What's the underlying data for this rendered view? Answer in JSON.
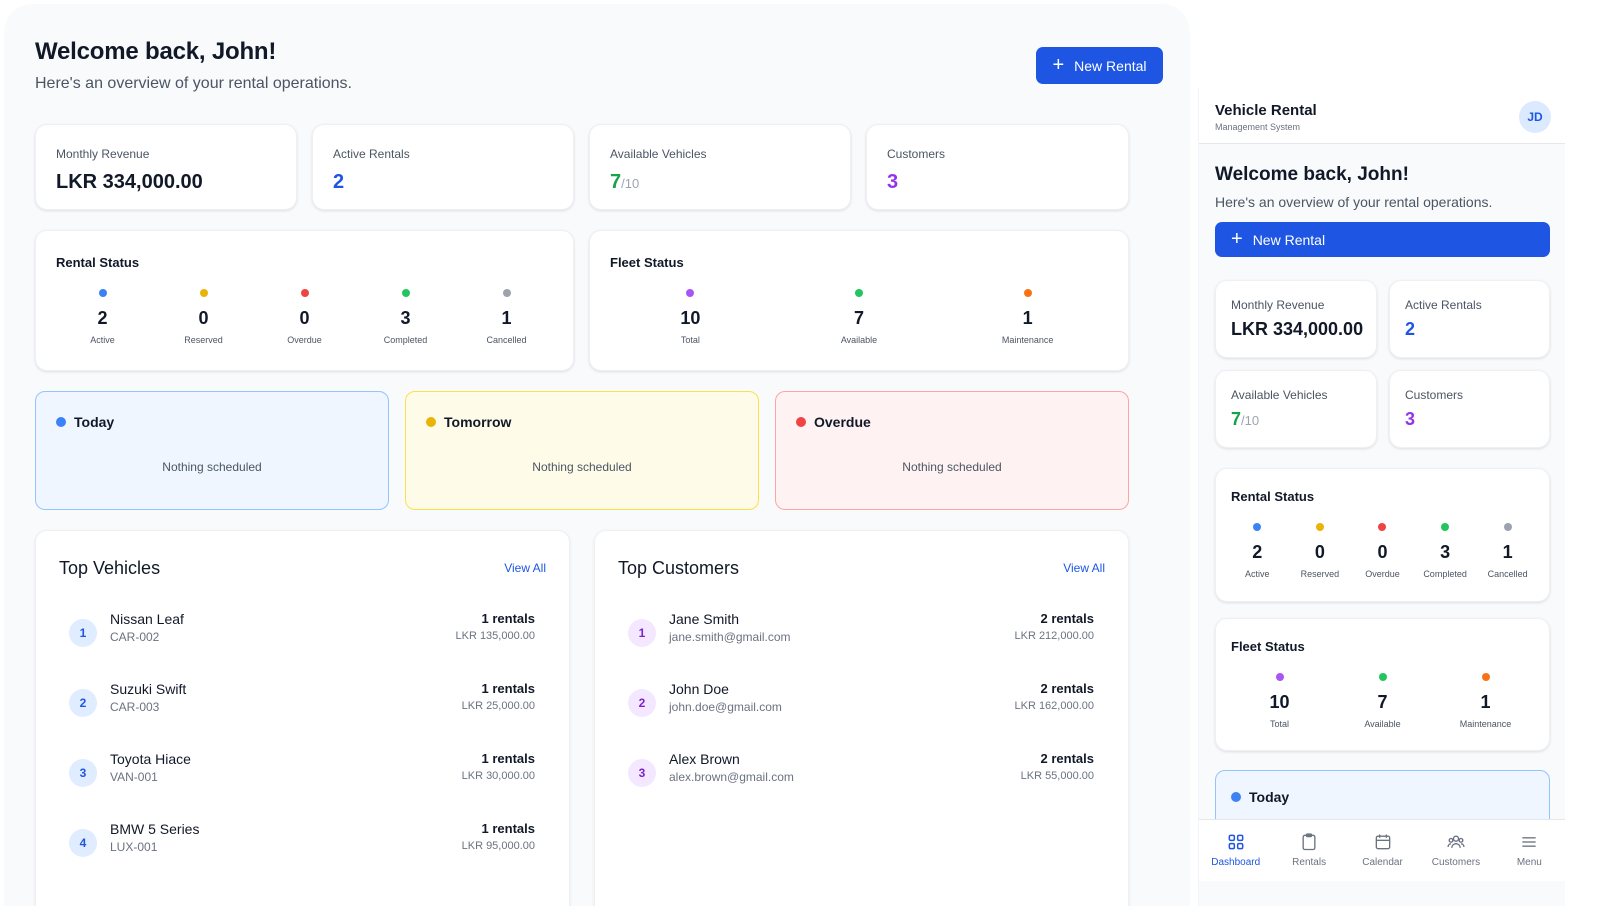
{
  "welcome": "Welcome back, John!",
  "subtitle": "Here's an overview of your rental operations.",
  "new_rental": "New Rental",
  "stats": {
    "revenue_label": "Monthly Revenue",
    "revenue_value": "LKR 334,000.00",
    "active_label": "Active Rentals",
    "active_value": "2",
    "available_label": "Available Vehicles",
    "available_value": "7",
    "available_total": "/10",
    "customers_label": "Customers",
    "customers_value": "3"
  },
  "rental_status": {
    "title": "Rental Status",
    "items": [
      {
        "value": "2",
        "label": "Active",
        "color": "#3b82f6"
      },
      {
        "value": "0",
        "label": "Reserved",
        "color": "#eab308"
      },
      {
        "value": "0",
        "label": "Overdue",
        "color": "#ef4444"
      },
      {
        "value": "3",
        "label": "Completed",
        "color": "#22c55e"
      },
      {
        "value": "1",
        "label": "Cancelled",
        "color": "#9ca3af"
      }
    ]
  },
  "fleet_status": {
    "title": "Fleet Status",
    "items": [
      {
        "value": "10",
        "label": "Total",
        "color": "#a855f7"
      },
      {
        "value": "7",
        "label": "Available",
        "color": "#22c55e"
      },
      {
        "value": "1",
        "label": "Maintenance",
        "color": "#f97316"
      }
    ]
  },
  "schedule": {
    "empty": "Nothing scheduled",
    "today": "Today",
    "tomorrow": "Tomorrow",
    "overdue": "Overdue"
  },
  "top_vehicles": {
    "title": "Top Vehicles",
    "view_all": "View All",
    "rows": [
      {
        "rank": "1",
        "name": "Nissan Leaf",
        "code": "CAR-002",
        "rentals": "1 rentals",
        "amount": "LKR 135,000.00"
      },
      {
        "rank": "2",
        "name": "Suzuki Swift",
        "code": "CAR-003",
        "rentals": "1 rentals",
        "amount": "LKR 25,000.00"
      },
      {
        "rank": "3",
        "name": "Toyota Hiace",
        "code": "VAN-001",
        "rentals": "1 rentals",
        "amount": "LKR 30,000.00"
      },
      {
        "rank": "4",
        "name": "BMW 5 Series",
        "code": "LUX-001",
        "rentals": "1 rentals",
        "amount": "LKR 95,000.00"
      }
    ]
  },
  "top_customers": {
    "title": "Top Customers",
    "view_all": "View All",
    "rows": [
      {
        "rank": "1",
        "name": "Jane Smith",
        "email": "jane.smith@gmail.com",
        "rentals": "2 rentals",
        "amount": "LKR 212,000.00"
      },
      {
        "rank": "2",
        "name": "John Doe",
        "email": "john.doe@gmail.com",
        "rentals": "2 rentals",
        "amount": "LKR 162,000.00"
      },
      {
        "rank": "3",
        "name": "Alex Brown",
        "email": "alex.brown@gmail.com",
        "rentals": "2 rentals",
        "amount": "LKR 55,000.00"
      }
    ]
  },
  "mobile": {
    "brand": "Vehicle Rental",
    "brand_sub": "Management System",
    "avatar": "JD",
    "nav": [
      {
        "label": "Dashboard",
        "icon": "grid-icon"
      },
      {
        "label": "Rentals",
        "icon": "clipboard-icon"
      },
      {
        "label": "Calendar",
        "icon": "calendar-icon"
      },
      {
        "label": "Customers",
        "icon": "users-icon"
      },
      {
        "label": "Menu",
        "icon": "menu-icon"
      }
    ]
  },
  "colors": {
    "primary": "#1e56e3",
    "green": "#16a34a",
    "purple": "#9333ea",
    "today_bg": "#eff6ff",
    "today_border": "#93c5fd",
    "tomorrow_bg": "#fefce8",
    "tomorrow_border": "#fde047",
    "overdue_bg": "#fef2f2",
    "overdue_border": "#fca5a5"
  }
}
